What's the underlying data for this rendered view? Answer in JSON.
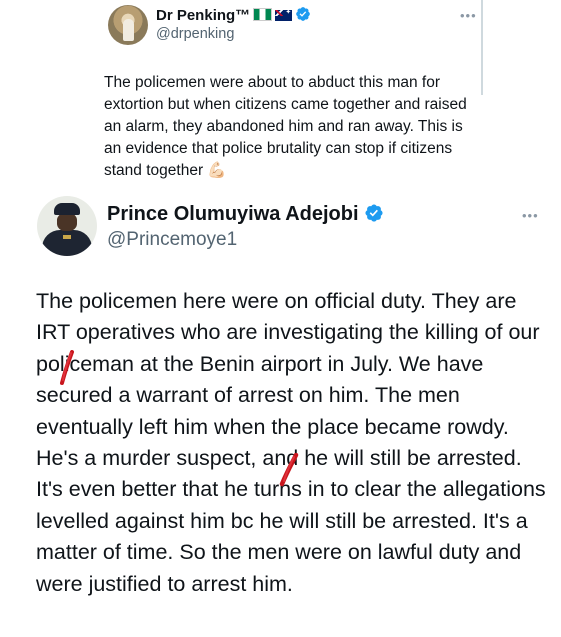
{
  "quoted_tweet": {
    "display_name": "Dr Penking™",
    "flags": [
      "nigeria-flag",
      "australia-flag"
    ],
    "handle": "@drpenking",
    "more_icon": "more-icon",
    "text": "The policemen were about to abduct this man for extortion but when citizens came together and raised an alarm, they abandoned him and ran away. This is an evidence that police brutality can stop if citizens stand together",
    "emoji": "💪🏻"
  },
  "main_tweet": {
    "display_name": "Prince Olumuyiwa Adejobi",
    "handle": "@Princemoye1",
    "more_icon": "more-icon",
    "text": "The policemen here were on official duty. They are IRT operatives who are investigating the killing of our policeman at the Benin airport in July. We have secured a warrant of arrest on him. The men eventually left him when the place became rowdy. He's a murder suspect, and he will still be arrested. It's even better that he turns in to clear the allegations levelled against him bc he will still be arrested. It's a matter of time. So the men were on lawful duty and were justified to arrest him."
  },
  "colors": {
    "verified_badge": "#1d9bf0",
    "text_primary": "#0f1419",
    "text_secondary": "#536471",
    "annotation_red": "#c8161d"
  }
}
